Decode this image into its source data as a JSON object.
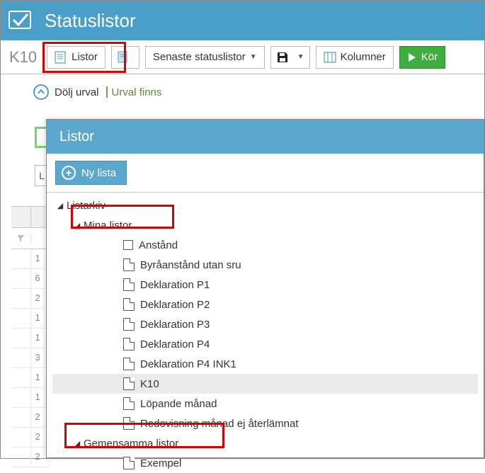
{
  "header": {
    "title": "Statuslistor"
  },
  "toolbar": {
    "context": "K10",
    "listor": "Listor",
    "recent": "Senaste statuslistor",
    "columns": "Kolumner",
    "run": "Kör"
  },
  "subbar": {
    "hide_selection": "Dölj urval",
    "selection_exists": "Urval finns"
  },
  "grid_stub_rows": [
    "1",
    "6",
    "2",
    "1",
    "1",
    "3",
    "1",
    "1",
    "2",
    "2",
    "2"
  ],
  "popup": {
    "title": "Listor",
    "new_list": "Ny lista",
    "tree": {
      "root": "Listarkiv",
      "mine_label": "Mina listor",
      "mine": [
        "Anstånd",
        "Byråanstånd utan sru",
        "Deklaration P1",
        "Deklaration P2",
        "Deklaration P3",
        "Deklaration P4",
        "Deklaration P4 INK1",
        "K10",
        "Löpande månad",
        "Redovisning månad ej återlämnat"
      ],
      "selected": "K10",
      "shared_label": "Gemensamma listor",
      "shared": [
        "Exempel"
      ]
    }
  }
}
